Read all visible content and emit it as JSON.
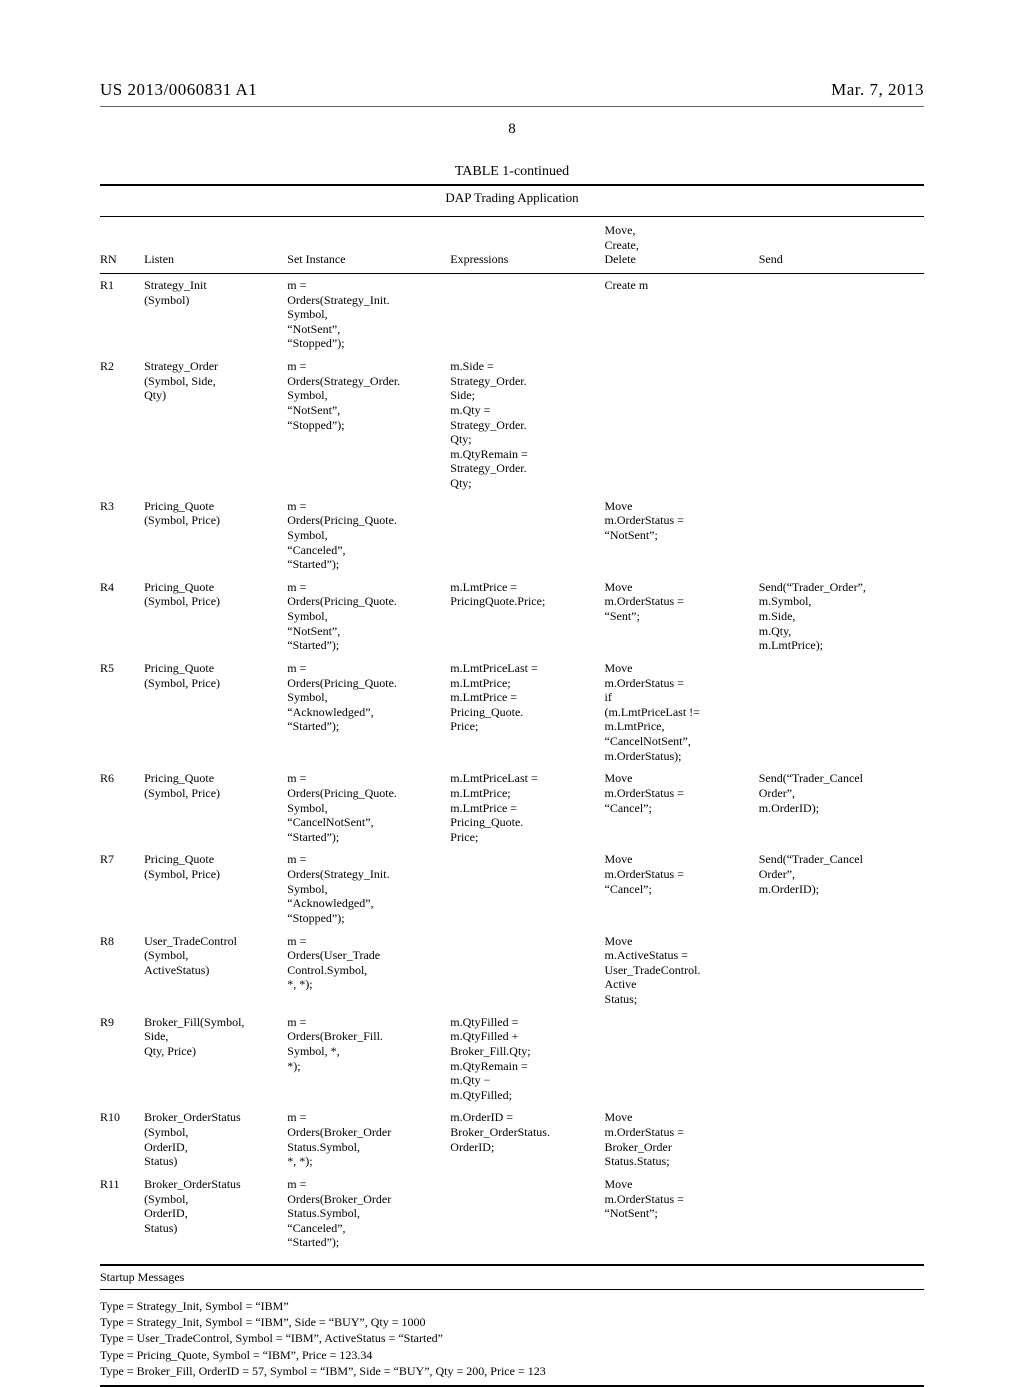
{
  "header": {
    "pub_number": "US 2013/0060831 A1",
    "date": "Mar. 7, 2013",
    "page_number": "8"
  },
  "table": {
    "caption": "TABLE 1-continued",
    "subtitle": "DAP Trading Application",
    "columns": {
      "rn": "RN",
      "listen": "Listen",
      "set": "Set Instance",
      "expr": "Expressions",
      "move": "Move,\nCreate,\nDelete",
      "send": "Send"
    },
    "rows": [
      {
        "rn": "R1",
        "listen": "Strategy_Init\n(Symbol)",
        "set": "m =\nOrders(Strategy_Init.\nSymbol,\n“NotSent”,\n“Stopped”);",
        "expr": "",
        "move": "Create m",
        "send": ""
      },
      {
        "rn": "R2",
        "listen": "Strategy_Order\n(Symbol, Side,\nQty)",
        "set": "m =\nOrders(Strategy_Order.\nSymbol,\n“NotSent”,\n“Stopped”);",
        "expr": "m.Side =\nStrategy_Order.\nSide;\nm.Qty =\nStrategy_Order.\nQty;\nm.QtyRemain =\nStrategy_Order.\nQty;",
        "move": "",
        "send": ""
      },
      {
        "rn": "R3",
        "listen": "Pricing_Quote\n(Symbol, Price)",
        "set": "m =\nOrders(Pricing_Quote.\nSymbol,\n“Canceled”,\n“Started”);",
        "expr": "",
        "move": "Move\nm.OrderStatus =\n“NotSent”;",
        "send": ""
      },
      {
        "rn": "R4",
        "listen": "Pricing_Quote\n(Symbol, Price)",
        "set": "m =\nOrders(Pricing_Quote.\nSymbol,\n“NotSent”,\n“Started”);",
        "expr": "m.LmtPrice =\nPricingQuote.Price;",
        "move": "Move\nm.OrderStatus =\n“Sent”;",
        "send": "Send(“Trader_Order”,\nm.Symbol,\nm.Side,\nm.Qty,\nm.LmtPrice);"
      },
      {
        "rn": "R5",
        "listen": "Pricing_Quote\n(Symbol, Price)",
        "set": "m =\nOrders(Pricing_Quote.\nSymbol,\n“Acknowledged”,\n“Started”);",
        "expr": "m.LmtPriceLast =\nm.LmtPrice;\nm.LmtPrice =\nPricing_Quote.\nPrice;",
        "move": "Move\nm.OrderStatus =\nif\n(m.LmtPriceLast !=\nm.LmtPrice,\n“CancelNotSent”,\nm.OrderStatus);",
        "send": ""
      },
      {
        "rn": "R6",
        "listen": "Pricing_Quote\n(Symbol, Price)",
        "set": "m =\nOrders(Pricing_Quote.\nSymbol,\n“CancelNotSent”,\n“Started”);",
        "expr": "m.LmtPriceLast =\nm.LmtPrice;\nm.LmtPrice =\nPricing_Quote.\nPrice;",
        "move": "Move\nm.OrderStatus =\n“Cancel”;",
        "send": "Send(“Trader_Cancel\nOrder”,\nm.OrderID);"
      },
      {
        "rn": "R7",
        "listen": "Pricing_Quote\n(Symbol, Price)",
        "set": "m =\nOrders(Strategy_Init.\nSymbol,\n“Acknowledged”,\n“Stopped”);",
        "expr": "",
        "move": "Move\nm.OrderStatus =\n“Cancel”;",
        "send": "Send(“Trader_Cancel\nOrder”,\nm.OrderID);"
      },
      {
        "rn": "R8",
        "listen": "User_TradeControl\n(Symbol,\nActiveStatus)",
        "set": "m =\nOrders(User_Trade\nControl.Symbol,\n*, *);",
        "expr": "",
        "move": "Move\nm.ActiveStatus =\nUser_TradeControl.\nActive\nStatus;",
        "send": ""
      },
      {
        "rn": "R9",
        "listen": "Broker_Fill(Symbol,\nSide,\nQty, Price)",
        "set": "m =\nOrders(Broker_Fill.\nSymbol, *,\n*);",
        "expr": "m.QtyFilled =\nm.QtyFilled +\nBroker_Fill.Qty;\nm.QtyRemain =\nm.Qty −\nm.QtyFilled;",
        "move": "",
        "send": ""
      },
      {
        "rn": "R10",
        "listen": "Broker_OrderStatus\n(Symbol,\nOrderID,\nStatus)",
        "set": "m =\nOrders(Broker_Order\nStatus.Symbol,\n*, *);",
        "expr": "m.OrderID =\nBroker_OrderStatus.\nOrderID;",
        "move": "Move\nm.OrderStatus =\nBroker_Order\nStatus.Status;",
        "send": ""
      },
      {
        "rn": "R11",
        "listen": "Broker_OrderStatus\n(Symbol,\nOrderID,\nStatus)",
        "set": "m =\nOrders(Broker_Order\nStatus.Symbol,\n“Canceled”,\n“Started”);",
        "expr": "",
        "move": "Move\nm.OrderStatus =\n“NotSent”;",
        "send": ""
      }
    ]
  },
  "startup": {
    "heading": "Startup Messages",
    "lines": [
      "Type = Strategy_Init, Symbol = “IBM”",
      "Type = Strategy_Init, Symbol = “IBM”, Side = “BUY”, Qty = 1000",
      "Type = User_TradeControl, Symbol = “IBM”, ActiveStatus = “Started”",
      "Type = Pricing_Quote, Symbol = “IBM”, Price = 123.34",
      "Type = Broker_Fill, OrderID = 57, Symbol = “IBM”, Side = “BUY”, Qty = 200, Price = 123"
    ]
  }
}
